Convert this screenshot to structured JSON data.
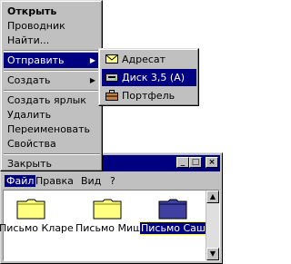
{
  "context_menu": {
    "items": [
      {
        "label": "Открыть",
        "bold": true
      },
      {
        "label": "Проводник"
      },
      {
        "label": "Найти..."
      },
      {
        "label": "Отправить",
        "submenu": true,
        "highlighted": true
      },
      {
        "label": "Создать",
        "submenu": true
      },
      {
        "label": "Создать ярлык"
      },
      {
        "label": "Удалить"
      },
      {
        "label": "Переименовать"
      },
      {
        "label": "Свойства"
      },
      {
        "label": "Закрыть"
      }
    ]
  },
  "send_to_menu": {
    "items": [
      {
        "label": "Адресат",
        "icon": "mail-recipient-icon"
      },
      {
        "label": "Диск 3,5 (A)",
        "icon": "floppy-drive-icon",
        "highlighted": true
      },
      {
        "label": "Портфель",
        "icon": "briefcase-icon"
      }
    ]
  },
  "window": {
    "menu": {
      "file": "Файл",
      "edit": "Правка",
      "view": "Вид",
      "help": "?"
    },
    "caption_buttons": {
      "minimize": "_",
      "maximize": "□",
      "close": "×"
    },
    "folders": [
      {
        "label": "Письмо Кларе"
      },
      {
        "label": "Письмо Мише"
      },
      {
        "label": "Письмо Саше",
        "selected": true
      }
    ]
  },
  "colors": {
    "menu_face": "#c0c0c0",
    "highlight": "#000080",
    "folder_yellow": "#ffff80"
  }
}
